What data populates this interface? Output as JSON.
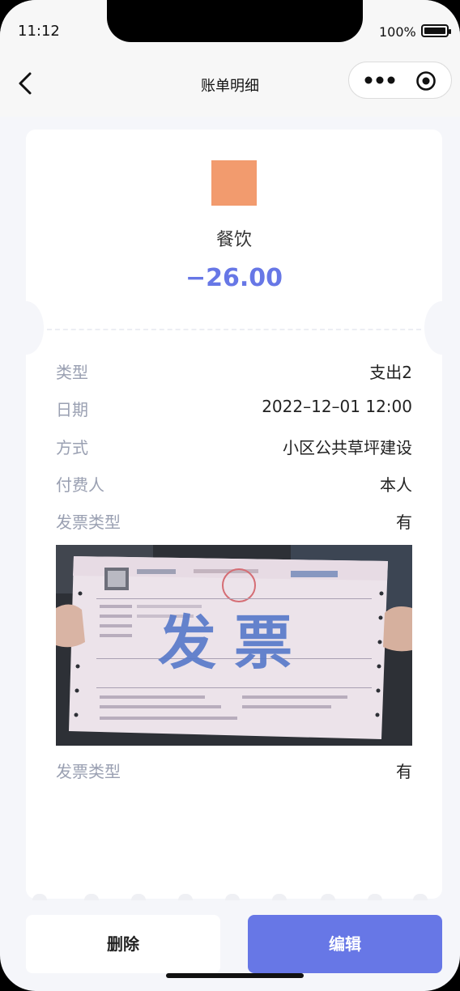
{
  "status_bar": {
    "time": "11:12",
    "battery": "100%"
  },
  "nav": {
    "title": "账单明细",
    "more_icon": "more-dots-icon",
    "close_icon": "target-icon"
  },
  "bill": {
    "category_icon_color": "#f29b6e",
    "category": "餐饮",
    "amount": "−26.00",
    "amount_color": "#6777e6"
  },
  "details": [
    {
      "label": "类型",
      "value": "支出2"
    },
    {
      "label": "日期",
      "value": "2022–12–01 12:00"
    },
    {
      "label": "方式",
      "value": "小区公共草坪建设"
    },
    {
      "label": "付费人",
      "value": "本人"
    },
    {
      "label": "发票类型",
      "value": "有"
    }
  ],
  "invoice_image": {
    "caption": "发票"
  },
  "details_after_image": [
    {
      "label": "发票类型",
      "value": "有"
    }
  ],
  "actions": {
    "delete": "删除",
    "edit": "编辑"
  },
  "colors": {
    "accent": "#6777e6",
    "label": "#9aa0b2",
    "background": "#f5f6fa"
  }
}
